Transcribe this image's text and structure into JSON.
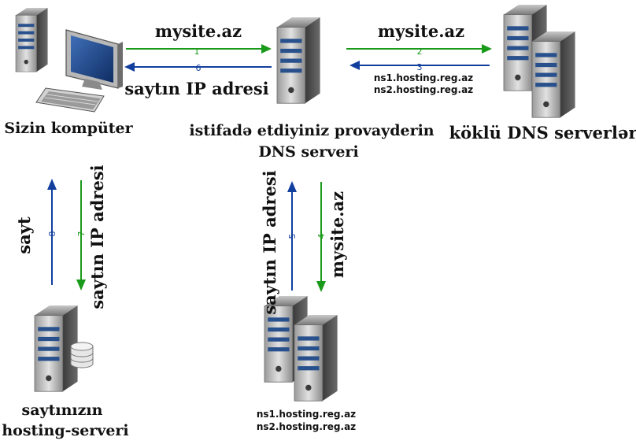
{
  "colors": {
    "green": "#1a9a1a",
    "blue": "#123f9e",
    "server_dark": "#4a4a4a",
    "server_light": "#d9d9d9",
    "stripe": "#28508c"
  },
  "nodes": {
    "your_computer": {
      "label": "Sizin kompüter"
    },
    "provider_dns": {
      "label_line1": "istifadə etdiyiniz provayderin",
      "label_line2": "DNS serveri"
    },
    "root_dns": {
      "label": "köklü DNS serverlər"
    },
    "hosting_server": {
      "label_line1": "saytınızın",
      "label_line2": "hosting-serveri"
    },
    "ns_servers": {
      "label_line1": "ns1.hosting.reg.az",
      "label_line2": "ns2.hosting.reg.az"
    }
  },
  "arrows": {
    "a1": {
      "step": "1",
      "label": "mysite.az"
    },
    "a2": {
      "step": "2",
      "label": "mysite.az"
    },
    "a3": {
      "step": "3",
      "label_line1": "ns1.hosting.reg.az",
      "label_line2": "ns2.hosting.reg.az"
    },
    "a4": {
      "step": "4",
      "label": "mysite.az"
    },
    "a5": {
      "step": "5",
      "label": "saytın IP adresi"
    },
    "a6": {
      "step": "6",
      "label": "saytın IP adresi"
    },
    "a7": {
      "step": "7",
      "label": "saytın IP adresi"
    },
    "a8": {
      "step": "8",
      "label": "sayt"
    }
  }
}
